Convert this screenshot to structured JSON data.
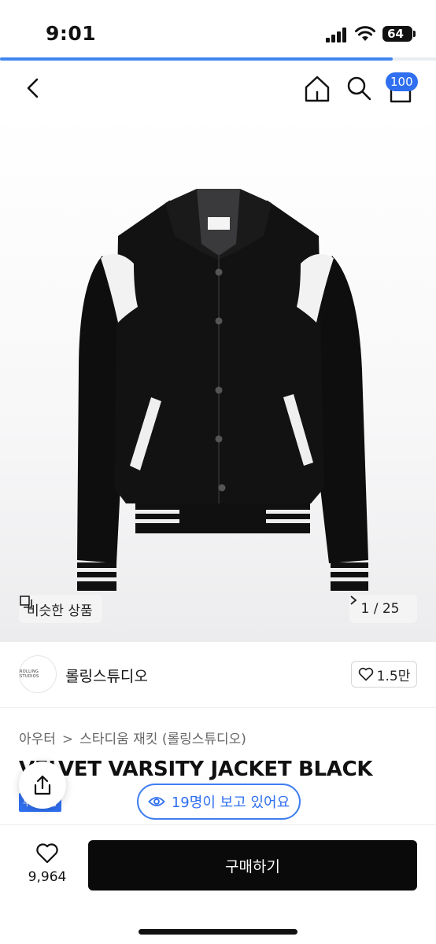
{
  "status_bar": {
    "time": "9:01",
    "battery": "64"
  },
  "page_progress": 0.9,
  "nav": {
    "cart_badge": "100"
  },
  "hero": {
    "similar_label": "비슷한 상품",
    "counter": "1 / 25"
  },
  "store": {
    "logo_text": "ROLLING STUDIOS",
    "name": "롤링스튜디오",
    "likes": "1.5만"
  },
  "breadcrumb": {
    "category": "아우터",
    "subcategory": "스타디움 재킷 (롤링스튜디오)"
  },
  "product": {
    "title_visible": "VELVET VARSITY JACKET BLACK",
    "tag": "무료배송"
  },
  "viewing": {
    "label": "19명이 보고 있어요"
  },
  "bottom": {
    "wish_count": "9,964",
    "buy_label": "구매하기"
  },
  "colors": {
    "accent": "#2f6ff0",
    "buy": "#0a0a0a"
  }
}
